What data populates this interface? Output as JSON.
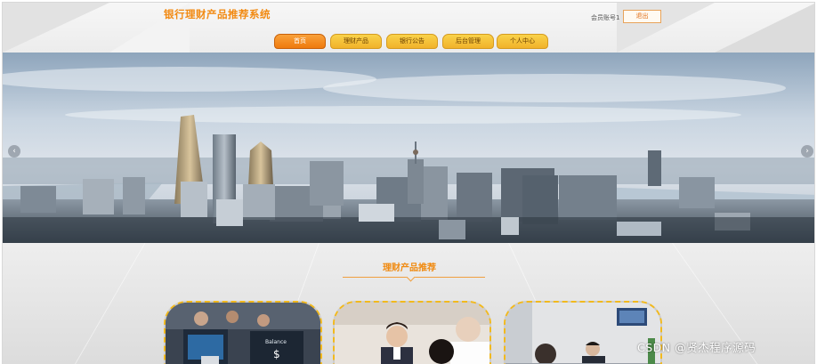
{
  "header": {
    "site_title": "银行理财产品推荐系统",
    "member_label": "会员账号1",
    "logout_label": "退出"
  },
  "nav": {
    "items": [
      {
        "label": "首页",
        "active": true
      },
      {
        "label": "理财产品",
        "active": false
      },
      {
        "label": "银行公告",
        "active": false
      },
      {
        "label": "后台管理",
        "active": false
      },
      {
        "label": "个人中心",
        "active": false
      }
    ]
  },
  "banner": {
    "prev_icon": "chevron-left-icon",
    "next_icon": "chevron-right-icon"
  },
  "section": {
    "title": "理财产品推荐"
  },
  "cards": [
    {
      "image_text": "Balance",
      "symbol": "$"
    },
    {
      "image_text": ""
    },
    {
      "image_text": ""
    }
  ],
  "watermark": "CSDN @贤杰程序源码",
  "colors": {
    "accent": "#f28a12",
    "nav_gold": "#f1b22a",
    "nav_active": "#ef7a0e",
    "card_border": "#f2b91d"
  }
}
